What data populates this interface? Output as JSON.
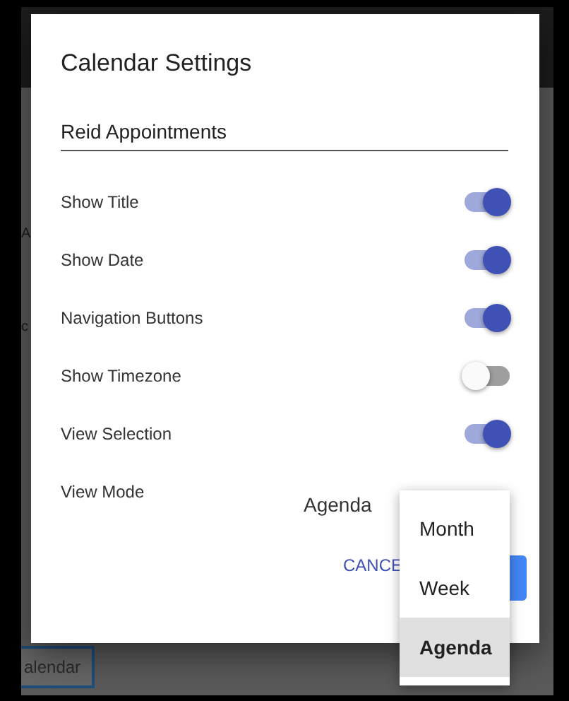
{
  "background": {
    "fragments": [
      {
        "text": "A",
        "kind": "heading"
      },
      {
        "text": "c",
        "kind": "link"
      }
    ],
    "button": "alendar"
  },
  "dialog": {
    "title": "Calendar Settings",
    "name_field": {
      "value": "Reid Appointments"
    },
    "settings": [
      {
        "label": "Show Title",
        "kind": "toggle",
        "on": true
      },
      {
        "label": "Show Date",
        "kind": "toggle",
        "on": true
      },
      {
        "label": "Navigation Buttons",
        "kind": "toggle",
        "on": true
      },
      {
        "label": "Show Timezone",
        "kind": "toggle",
        "on": false
      },
      {
        "label": "View Selection",
        "kind": "toggle",
        "on": true
      },
      {
        "label": "View Mode",
        "kind": "select",
        "value": "Agenda"
      }
    ],
    "buttons": [
      {
        "label": "CANCE",
        "kind": "text"
      },
      {
        "kind": "primary"
      }
    ]
  },
  "dropdown": {
    "options": [
      {
        "label": "Month",
        "selected": false
      },
      {
        "label": "Week",
        "selected": false
      },
      {
        "label": "Agenda",
        "selected": true
      }
    ]
  }
}
